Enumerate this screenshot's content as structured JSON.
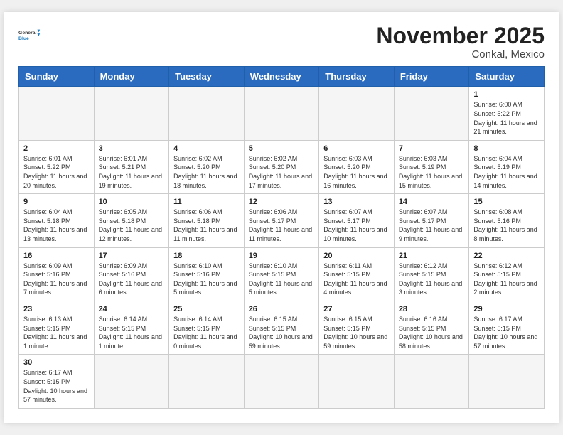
{
  "header": {
    "logo_general": "General",
    "logo_blue": "Blue",
    "month_title": "November 2025",
    "location": "Conkal, Mexico"
  },
  "weekdays": [
    "Sunday",
    "Monday",
    "Tuesday",
    "Wednesday",
    "Thursday",
    "Friday",
    "Saturday"
  ],
  "days": [
    {
      "date": null,
      "info": null
    },
    {
      "date": null,
      "info": null
    },
    {
      "date": null,
      "info": null
    },
    {
      "date": null,
      "info": null
    },
    {
      "date": null,
      "info": null
    },
    {
      "date": null,
      "info": null
    },
    {
      "date": "1",
      "sunrise": "6:00 AM",
      "sunset": "5:22 PM",
      "daylight": "11 hours and 21 minutes."
    },
    {
      "date": "2",
      "sunrise": "6:01 AM",
      "sunset": "5:22 PM",
      "daylight": "11 hours and 20 minutes."
    },
    {
      "date": "3",
      "sunrise": "6:01 AM",
      "sunset": "5:21 PM",
      "daylight": "11 hours and 19 minutes."
    },
    {
      "date": "4",
      "sunrise": "6:02 AM",
      "sunset": "5:20 PM",
      "daylight": "11 hours and 18 minutes."
    },
    {
      "date": "5",
      "sunrise": "6:02 AM",
      "sunset": "5:20 PM",
      "daylight": "11 hours and 17 minutes."
    },
    {
      "date": "6",
      "sunrise": "6:03 AM",
      "sunset": "5:20 PM",
      "daylight": "11 hours and 16 minutes."
    },
    {
      "date": "7",
      "sunrise": "6:03 AM",
      "sunset": "5:19 PM",
      "daylight": "11 hours and 15 minutes."
    },
    {
      "date": "8",
      "sunrise": "6:04 AM",
      "sunset": "5:19 PM",
      "daylight": "11 hours and 14 minutes."
    },
    {
      "date": "9",
      "sunrise": "6:04 AM",
      "sunset": "5:18 PM",
      "daylight": "11 hours and 13 minutes."
    },
    {
      "date": "10",
      "sunrise": "6:05 AM",
      "sunset": "5:18 PM",
      "daylight": "11 hours and 12 minutes."
    },
    {
      "date": "11",
      "sunrise": "6:06 AM",
      "sunset": "5:18 PM",
      "daylight": "11 hours and 11 minutes."
    },
    {
      "date": "12",
      "sunrise": "6:06 AM",
      "sunset": "5:17 PM",
      "daylight": "11 hours and 11 minutes."
    },
    {
      "date": "13",
      "sunrise": "6:07 AM",
      "sunset": "5:17 PM",
      "daylight": "11 hours and 10 minutes."
    },
    {
      "date": "14",
      "sunrise": "6:07 AM",
      "sunset": "5:17 PM",
      "daylight": "11 hours and 9 minutes."
    },
    {
      "date": "15",
      "sunrise": "6:08 AM",
      "sunset": "5:16 PM",
      "daylight": "11 hours and 8 minutes."
    },
    {
      "date": "16",
      "sunrise": "6:09 AM",
      "sunset": "5:16 PM",
      "daylight": "11 hours and 7 minutes."
    },
    {
      "date": "17",
      "sunrise": "6:09 AM",
      "sunset": "5:16 PM",
      "daylight": "11 hours and 6 minutes."
    },
    {
      "date": "18",
      "sunrise": "6:10 AM",
      "sunset": "5:16 PM",
      "daylight": "11 hours and 5 minutes."
    },
    {
      "date": "19",
      "sunrise": "6:10 AM",
      "sunset": "5:15 PM",
      "daylight": "11 hours and 5 minutes."
    },
    {
      "date": "20",
      "sunrise": "6:11 AM",
      "sunset": "5:15 PM",
      "daylight": "11 hours and 4 minutes."
    },
    {
      "date": "21",
      "sunrise": "6:12 AM",
      "sunset": "5:15 PM",
      "daylight": "11 hours and 3 minutes."
    },
    {
      "date": "22",
      "sunrise": "6:12 AM",
      "sunset": "5:15 PM",
      "daylight": "11 hours and 2 minutes."
    },
    {
      "date": "23",
      "sunrise": "6:13 AM",
      "sunset": "5:15 PM",
      "daylight": "11 hours and 1 minute."
    },
    {
      "date": "24",
      "sunrise": "6:14 AM",
      "sunset": "5:15 PM",
      "daylight": "11 hours and 1 minute."
    },
    {
      "date": "25",
      "sunrise": "6:14 AM",
      "sunset": "5:15 PM",
      "daylight": "11 hours and 0 minutes."
    },
    {
      "date": "26",
      "sunrise": "6:15 AM",
      "sunset": "5:15 PM",
      "daylight": "10 hours and 59 minutes."
    },
    {
      "date": "27",
      "sunrise": "6:15 AM",
      "sunset": "5:15 PM",
      "daylight": "10 hours and 59 minutes."
    },
    {
      "date": "28",
      "sunrise": "6:16 AM",
      "sunset": "5:15 PM",
      "daylight": "10 hours and 58 minutes."
    },
    {
      "date": "29",
      "sunrise": "6:17 AM",
      "sunset": "5:15 PM",
      "daylight": "10 hours and 57 minutes."
    },
    {
      "date": "30",
      "sunrise": "6:17 AM",
      "sunset": "5:15 PM",
      "daylight": "10 hours and 57 minutes."
    },
    {
      "date": null,
      "info": null
    },
    {
      "date": null,
      "info": null
    },
    {
      "date": null,
      "info": null
    },
    {
      "date": null,
      "info": null
    },
    {
      "date": null,
      "info": null
    },
    {
      "date": null,
      "info": null
    }
  ],
  "labels": {
    "sunrise": "Sunrise:",
    "sunset": "Sunset:",
    "daylight": "Daylight:"
  }
}
